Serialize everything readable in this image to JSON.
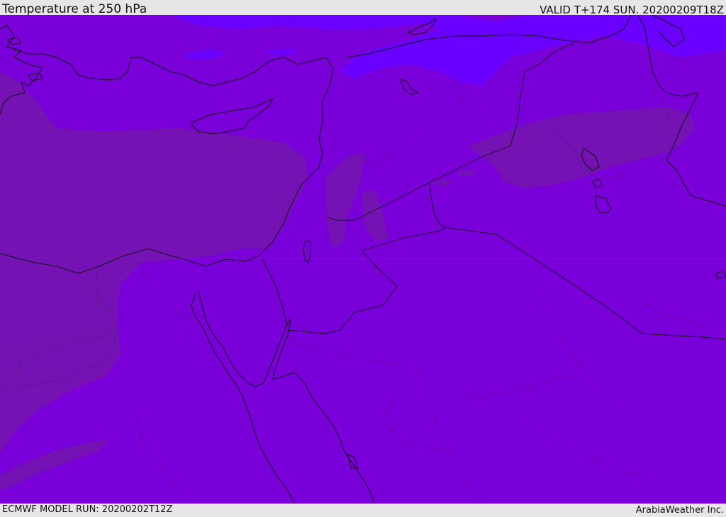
{
  "header": {
    "title": "Temperature at 250 hPa",
    "valid": "VALID T+174 SUN. 20200209T18Z"
  },
  "footer": {
    "model_run": "ECMWF MODEL RUN: 20200202T12Z",
    "credit": "ArabiaWeather Inc."
  },
  "map": {
    "colors": {
      "base": "#7a00d9",
      "warm_band": "#7412b3",
      "cold_band": "#6a00ff",
      "coast": "#111111"
    }
  }
}
